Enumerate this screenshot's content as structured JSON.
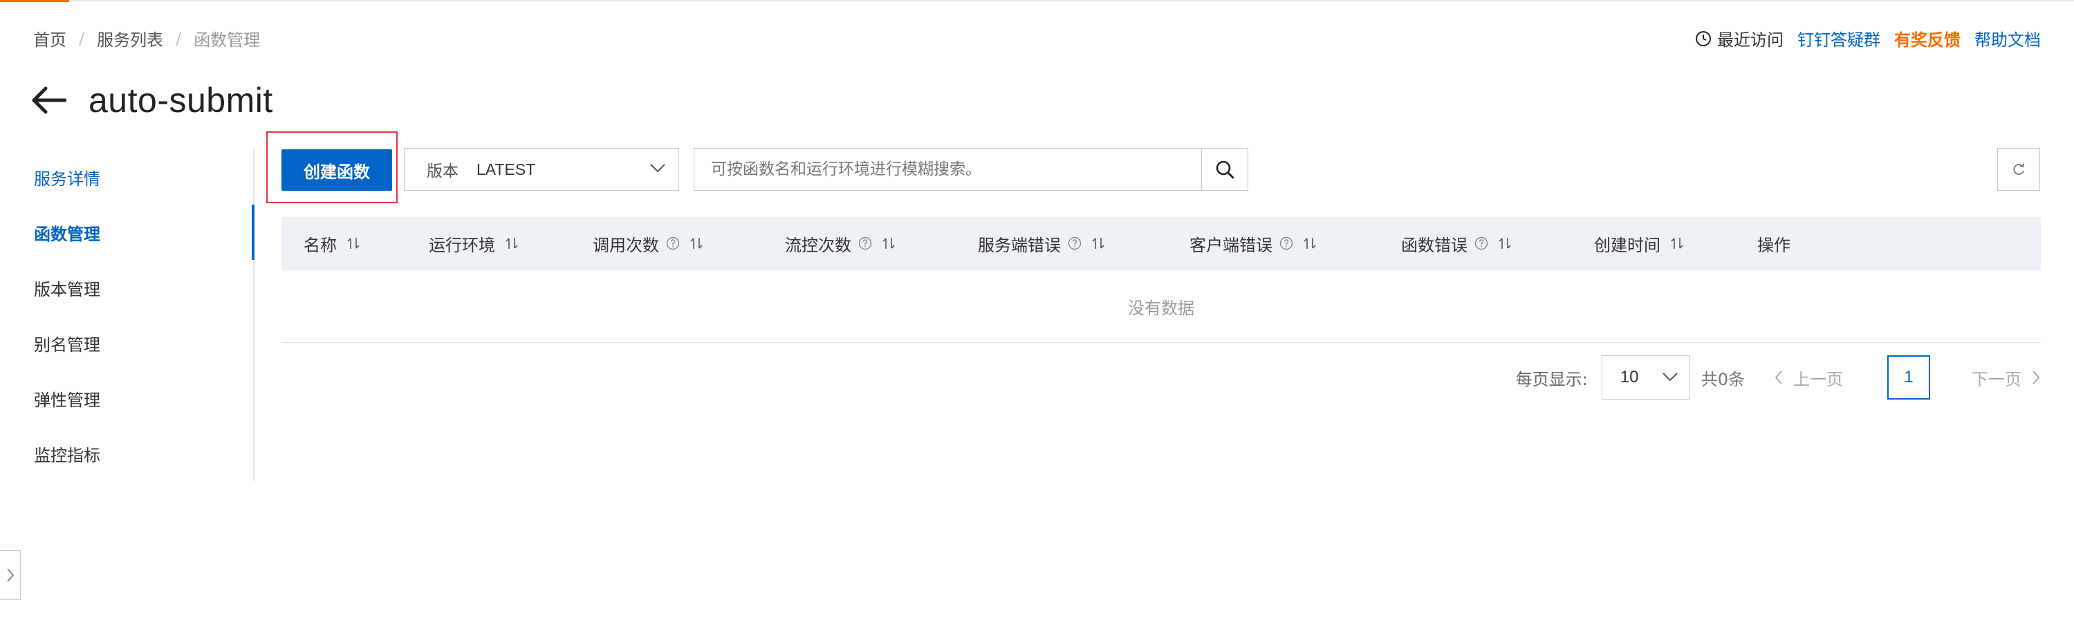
{
  "breadcrumb": [
    "首页",
    "服务列表",
    "函数管理"
  ],
  "header_links": {
    "recent": "最近访问",
    "dingtalk": "钉钉答疑群",
    "feedback": "有奖反馈",
    "help": "帮助文档"
  },
  "page_title": "auto-submit",
  "sidebar": {
    "items": [
      {
        "label": "服务详情"
      },
      {
        "label": "函数管理"
      },
      {
        "label": "版本管理"
      },
      {
        "label": "别名管理"
      },
      {
        "label": "弹性管理"
      },
      {
        "label": "监控指标"
      }
    ],
    "active_index": 1
  },
  "toolbar": {
    "create_label": "创建函数",
    "version_label": "版本",
    "version_value": "LATEST",
    "search_placeholder": "可按函数名和运行环境进行模糊搜索。"
  },
  "table": {
    "columns": [
      "名称",
      "运行环境",
      "调用次数",
      "流控次数",
      "服务端错误",
      "客户端错误",
      "函数错误",
      "创建时间",
      "操作"
    ],
    "empty_text": "没有数据"
  },
  "pagination": {
    "page_size_label": "每页显示:",
    "page_size": "10",
    "total": "共0条",
    "prev": "上一页",
    "current_page": "1",
    "next": "下一页"
  },
  "colors": {
    "primary": "#0064c8",
    "accent_orange": "#ff6a00",
    "highlight_red": "#e5343b"
  }
}
